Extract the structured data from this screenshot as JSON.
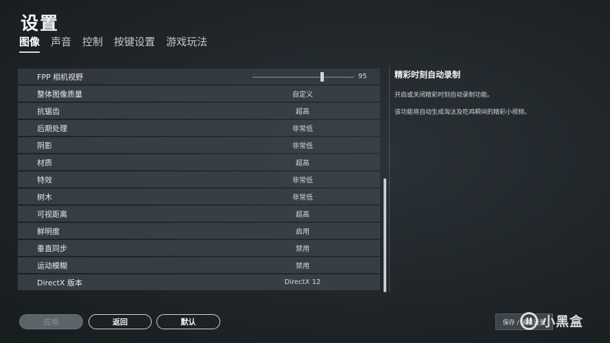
{
  "page": {
    "title": "设置"
  },
  "tabs": [
    {
      "label": "图像",
      "active": true
    },
    {
      "label": "声音"
    },
    {
      "label": "控制"
    },
    {
      "label": "按键设置"
    },
    {
      "label": "游戏玩法"
    }
  ],
  "settings": {
    "fpp": {
      "label": "FPP 相机视野",
      "value": "95",
      "slider_fraction": 0.68
    },
    "rows": [
      {
        "label": "整体图像质量",
        "value": "自定义"
      },
      {
        "label": "抗锯齿",
        "value": "超高"
      },
      {
        "label": "后期处理",
        "value": "非常低"
      },
      {
        "label": "阴影",
        "value": "非常低"
      },
      {
        "label": "材质",
        "value": "超高"
      },
      {
        "label": "特效",
        "value": "非常低"
      },
      {
        "label": "树木",
        "value": "非常低"
      },
      {
        "label": "可视距离",
        "value": "超高"
      },
      {
        "label": "鲜明度",
        "value": "启用"
      },
      {
        "label": "垂直同步",
        "value": "禁用"
      },
      {
        "label": "运动模糊",
        "value": "禁用"
      },
      {
        "label": "DirectX 版本",
        "value": "DirectX 12"
      }
    ]
  },
  "info": {
    "title": "精彩时刻自动录制",
    "line1": "开启或关闭精彩时刻自动录制功能。",
    "line2": "该功能将自动生成淘汰及吃鸡瞬间的精彩小视频。"
  },
  "buttons": {
    "apply": "应用",
    "back": "返回",
    "default": "默认",
    "save": "保存 / 装载设置"
  },
  "watermark": {
    "text": "小黑盒"
  }
}
